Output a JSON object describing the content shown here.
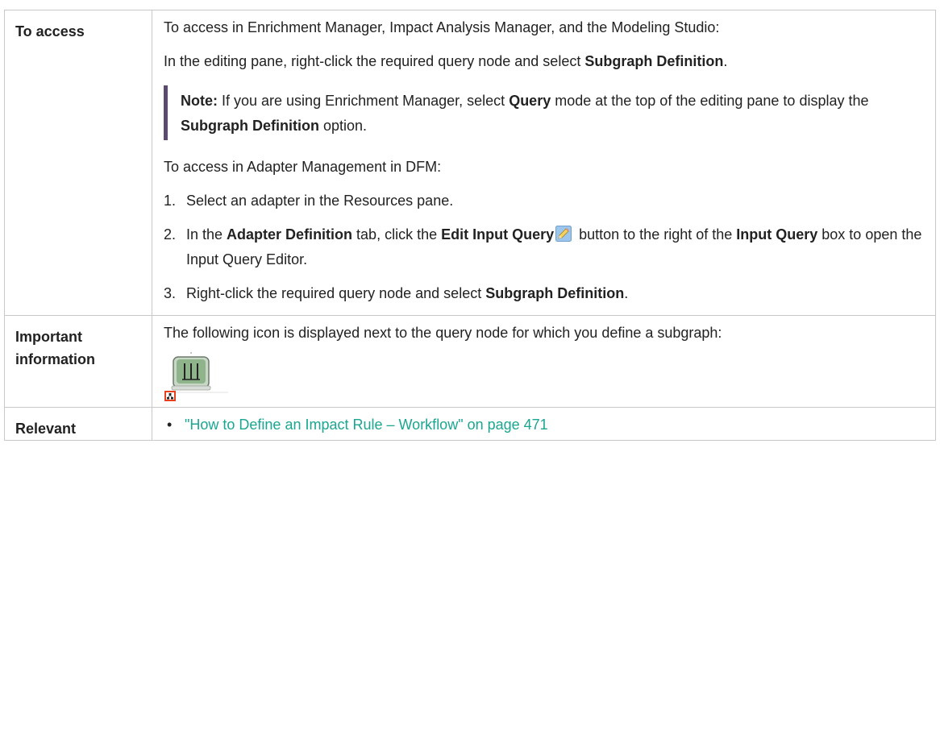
{
  "rows": {
    "access": {
      "header": "To access",
      "intro": "To access in Enrichment Manager, Impact Analysis Manager, and the Modeling Studio:",
      "editing": {
        "pre": "In the editing pane, right-click the required query node and select ",
        "bold": "Subgraph Definition",
        "post": "."
      },
      "note": {
        "label": "Note:",
        "t1": " If you are using Enrichment Manager, select ",
        "b1": "Query",
        "t2": " mode at the top of the editing pane to display the ",
        "b2": "Subgraph Definition",
        "t3": " option."
      },
      "dfm_intro": "To access in Adapter Management in DFM:",
      "steps": [
        {
          "num": "1.",
          "text": "Select an adapter in the Resources pane."
        },
        {
          "num": "2.",
          "t1": "In the ",
          "b1": "Adapter Definition",
          "t2": " tab, click the ",
          "b2": "Edit Input Query",
          "t3": " button to the right of the ",
          "b3": "Input Query",
          "t4": " box to open the Input Query Editor."
        },
        {
          "num": "3.",
          "t1": "Right-click the required query node and select ",
          "b1": "Subgraph Definition",
          "t2": "."
        }
      ],
      "pencil_icon": "pencil-edit-icon"
    },
    "important": {
      "header": "Important information",
      "text": "The following icon is displayed next to the query node for which you define a subgraph:",
      "icon": "subgraph-query-node-icon"
    },
    "relevant": {
      "header": "Relevant",
      "links": [
        "\"How to Define an Impact Rule – Workflow\" on page 471"
      ]
    }
  },
  "colors": {
    "link": "#1aa690",
    "note_bar": "#5a4a6e",
    "border": "#c8c8c8",
    "icon_badge": "#e8401c"
  }
}
